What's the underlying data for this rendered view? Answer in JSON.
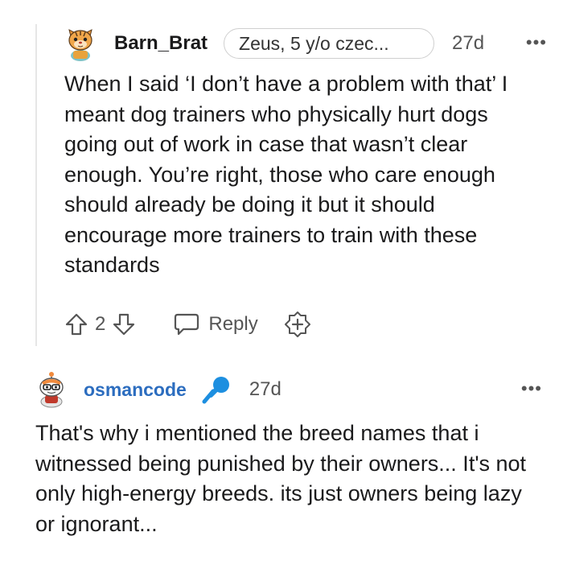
{
  "comment1": {
    "username": "Barn_Brat",
    "flair": "Zeus, 5 y/o czec...",
    "age": "27d",
    "more": "•••",
    "body": "When I said ‘I don’t have a problem with that’ I meant dog trainers who physically hurt dogs going out of work in case that wasn’t clear enough. You’re right, those who care enough should already be doing it but it should encourage more trainers to train with these standards",
    "votes": "2",
    "reply_label": "Reply"
  },
  "comment2": {
    "username": "osmancode",
    "age": "27d",
    "more": "•••",
    "body": "That's why i mentioned the breed names that i witnessed being punished by their owners... It's not only high-energy breeds. its just owners being lazy or ignorant..."
  },
  "colors": {
    "username2": "#2c6dbf",
    "mic_icon": "#1d8fe0",
    "thread_line": "#e6e6e6"
  },
  "icons": [
    "avatar-tiger",
    "upvote-icon",
    "downvote-icon",
    "reply-icon",
    "award-icon",
    "avatar-snoo",
    "microphone-icon",
    "more-options-icon"
  ]
}
